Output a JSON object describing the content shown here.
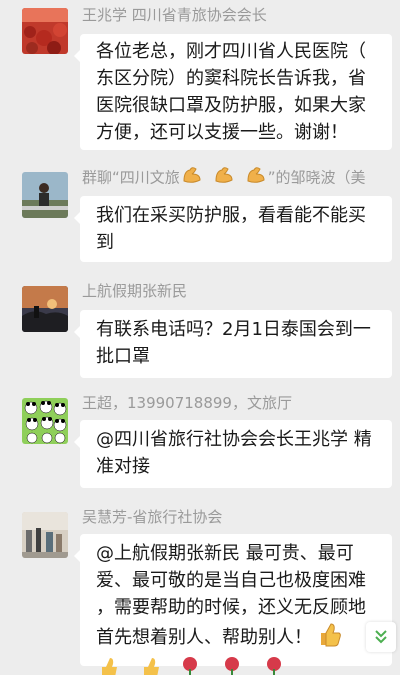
{
  "messages": [
    {
      "sender": "王兆学 四川省青旅协会会长",
      "avatar": "red-flower-field-avatar",
      "lines": [
        "各位老总，刚才四川省人民医院（",
        "东区分院）的窦科院长告诉我，省",
        "医院很缺口罩及防护服，如果大家",
        "方便，还可以支援一些。谢谢！"
      ]
    },
    {
      "sender_prefix": "群聊“四川文旅",
      "sender_suffix": "”的邹晓波（美",
      "sender_emoji": "flexed-biceps-emoji",
      "avatar": "person-outdoors-avatar",
      "lines": [
        "我们在采买防护服，看看能不能买",
        "到"
      ]
    },
    {
      "sender": "上航假期张新民",
      "avatar": "sunset-silhouette-avatar",
      "lines": [
        "有联系电话吗？2月1日泰国会到一",
        "批口罩"
      ]
    },
    {
      "sender": "王超，13990718899，文旅厅",
      "avatar": "panda-collage-avatar",
      "lines": [
        "@四川省旅行社协会会长王兆学 精",
        "准对接"
      ]
    },
    {
      "sender": "吴慧芳-省旅行社协会",
      "avatar": "street-photo-avatar",
      "lines": [
        "@上航假期张新民    最可贵、最可",
        "爱、最可敬的是当自己也极度困难",
        "，需要帮助的时候，还义无反顾地",
        "首先想着别人、帮助别人！"
      ],
      "trailing_emoji": "thumbs-up-emoji",
      "bottom_emojis": [
        "thumbs-up-emoji",
        "thumbs-up-emoji",
        "rose-emoji",
        "rose-emoji",
        "rose-emoji"
      ]
    }
  ],
  "scroll_icon": "double-chevron-down-icon",
  "colors": {
    "background": "#ededed",
    "bubble": "#ffffff",
    "sender_text": "#9a9a9a",
    "accent_green": "#4caf50"
  }
}
